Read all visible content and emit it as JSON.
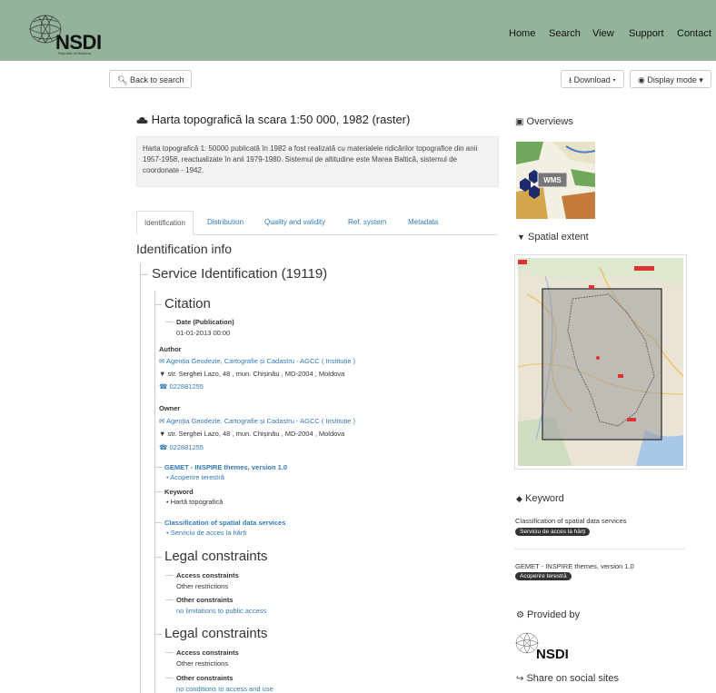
{
  "header": {
    "logo_text": "NSDI",
    "logo_sub": "Republic of Moldova",
    "nav": [
      "Home",
      "Search",
      "View",
      "Support",
      "Contact"
    ]
  },
  "toolbar": {
    "back_label": "Back to search",
    "download_label": "Download",
    "display_label": "Display mode"
  },
  "record": {
    "title": "Harta topografică la scara 1:50 000, 1982 (raster)",
    "abstract": "Harta topografică 1: 50000 publicată în 1982 a fost realizată cu materialele ridicărilor topografice din anii 1957-1958, reactualizate în anii 1979-1980. Sistemul de altitudine este Marea Baltică, sistemul de coordonate - 1942."
  },
  "tabs": [
    "Identification",
    "Distribution",
    "Quality and validity",
    "Ref. system",
    "Metadata"
  ],
  "identification": {
    "heading": "Identification info",
    "service": "Service Identification (19119)",
    "citation": {
      "heading": "Citation",
      "date_label": "Date (Publication)",
      "date_value": "01-01-2013 00:00"
    },
    "author": {
      "label": "Author",
      "org": "Agenția Geodezie, Cartografie și Cadastru - AGCC ( Instituție )",
      "address": "str. Serghei Lazo, 48 , mun. Chișinău , MD-2004 , Moldova",
      "phone": "022881255"
    },
    "owner": {
      "label": "Owner",
      "org": "Agenția Geodezie, Cartografie și Cadastru - AGCC ( Instituție )",
      "address": "str. Serghei Lazo, 48 , mun. Chișinău , MD-2004 , Moldova",
      "phone": "022881255"
    },
    "gemet": {
      "label": "GEMET - INSPIRE themes, version 1.0",
      "item": "Acoperire terestră"
    },
    "keyword": {
      "label": "Keyword",
      "item": "Hartă topografică"
    },
    "classification": {
      "label": "Classification of spatial data services",
      "item": "Serviciu de acces la hărți"
    },
    "legal1": {
      "heading": "Legal constraints",
      "access_label": "Access constraints",
      "access_value": "Other restrictions",
      "other_label": "Other constraints",
      "other_value": "no limitations to public access"
    },
    "legal2": {
      "heading": "Legal constraints",
      "access_label": "Access constraints",
      "access_value": "Other restrictions",
      "other_label": "Other constraints",
      "other_value": "no conditions to access and use"
    }
  },
  "sidebar": {
    "overviews": "Overviews",
    "wms": "WMS",
    "spatial_extent": "Spatial extent",
    "keyword_heading": "Keyword",
    "kw1_label": "Classification of spatial data services",
    "kw1_badge": "Serviciu de acces la hărți",
    "kw2_label": "GEMET - INSPIRE themes, version 1.0",
    "kw2_badge": "Acoperire terestră",
    "provided_by": "Provided by",
    "provider_logo": "NSDI",
    "share": "Share on social sites"
  },
  "colors": {
    "header": "#93b39b",
    "link": "#337ab7"
  }
}
